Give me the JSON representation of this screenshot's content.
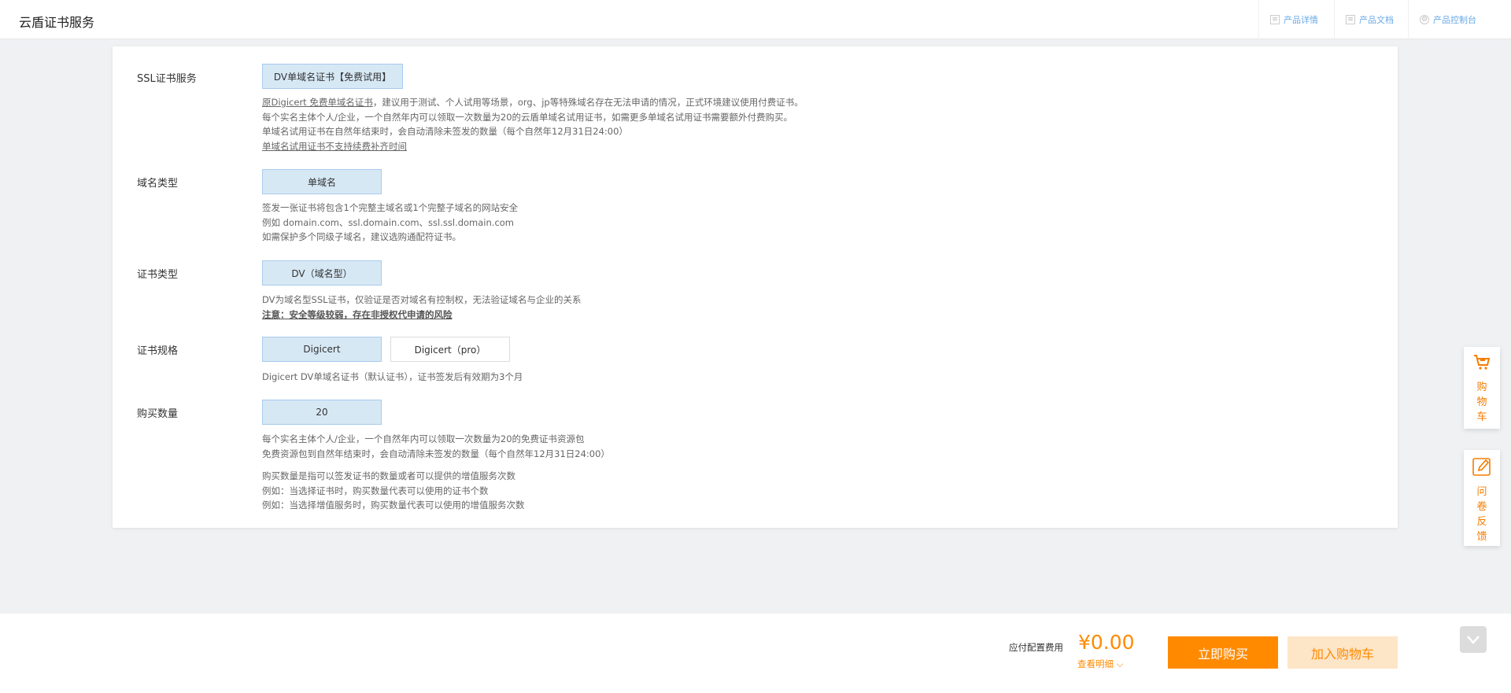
{
  "header": {
    "title": "云盾证书服务",
    "nav": [
      {
        "label": "产品详情",
        "icon": "document-icon"
      },
      {
        "label": "产品文档",
        "icon": "book-icon"
      },
      {
        "label": "产品控制台",
        "icon": "gear-icon"
      }
    ]
  },
  "form": {
    "ssl": {
      "label": "SSL证书服务",
      "option": "DV单域名证书【免费试用】",
      "desc": [
        "原Digicert 免费单域名证书",
        "，建议用于测试、个人试用等场景，org、jp等特殊域名存在无法申请的情况，正式环境建议使用付费证书。",
        "每个实名主体个人/企业，一个自然年内可以领取一次数量为20的云盾单域名试用证书，如需更多单域名试用证书需要额外付费购买。",
        "单域名试用证书在自然年结束时，会自动清除未签发的数量（每个自然年12月31日24:00）",
        "单域名试用证书不支持续费补齐时间"
      ]
    },
    "domain": {
      "label": "域名类型",
      "option": "单域名",
      "desc": [
        "签发一张证书将包含1个完整主域名或1个完整子域名的网站安全",
        "例如 domain.com、ssl.domain.com、ssl.ssl.domain.com",
        "如需保护多个同级子域名，建议选购通配符证书。"
      ]
    },
    "certtype": {
      "label": "证书类型",
      "option": "DV（域名型）",
      "desc": [
        "DV为域名型SSL证书，仅验证是否对域名有控制权，无法验证域名与企业的关系",
        "注意：安全等级较弱，存在非授权代申请的风险"
      ]
    },
    "spec": {
      "label": "证书规格",
      "options": [
        "Digicert",
        "Digicert（pro）"
      ],
      "desc": [
        "Digicert DV单域名证书（默认证书），证书签发后有效期为3个月"
      ]
    },
    "qty": {
      "label": "购买数量",
      "value": "20",
      "desc": [
        "每个实名主体个人/企业，一个自然年内可以领取一次数量为20的免费证书资源包",
        "免费资源包到自然年结束时，会自动清除未签发的数量（每个自然年12月31日24:00）",
        "购买数量是指可以签发证书的数量或者可以提供的增值服务次数",
        "例如：当选择证书时，购买数量代表可以使用的证书个数",
        "例如：当选择增值服务时，购买数量代表可以使用的增值服务次数"
      ]
    }
  },
  "side": {
    "cart": "购物车",
    "survey": "问卷反馈"
  },
  "footer": {
    "fee_label": "应付配置费用",
    "price": "¥0.00",
    "detail": "查看明细",
    "buy": "立即购买",
    "add_cart": "加入购物车"
  },
  "colors": {
    "accent": "#ff8a00",
    "selected": "#d7e8f5",
    "link": "#6aa9e6"
  }
}
